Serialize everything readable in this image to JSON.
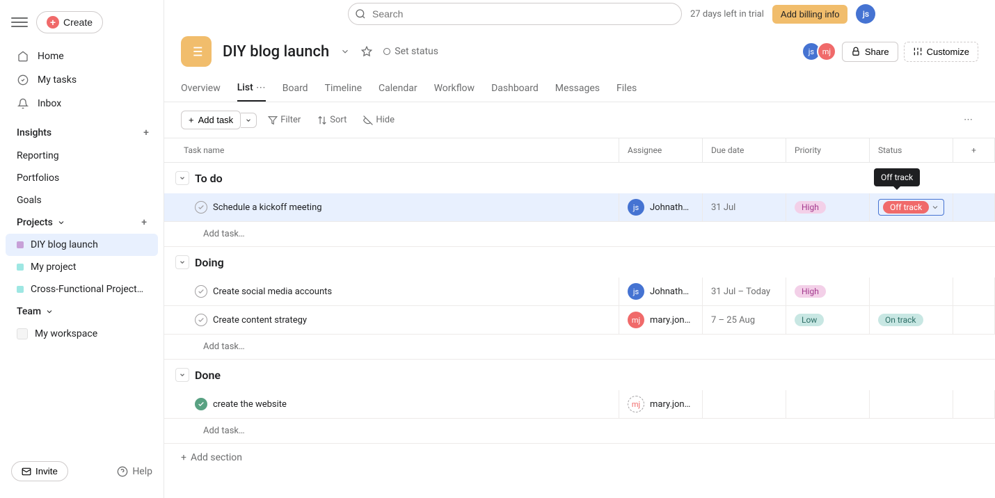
{
  "topbar": {
    "create_label": "Create",
    "search_placeholder": "Search",
    "trial_text": "27 days left in trial",
    "billing_label": "Add billing info",
    "user_initials": "js"
  },
  "sidebar": {
    "nav": [
      {
        "label": "Home",
        "icon": "home-icon"
      },
      {
        "label": "My tasks",
        "icon": "check-icon"
      },
      {
        "label": "Inbox",
        "icon": "bell-icon"
      }
    ],
    "insights_label": "Insights",
    "insights": [
      {
        "label": "Reporting"
      },
      {
        "label": "Portfolios"
      },
      {
        "label": "Goals"
      }
    ],
    "projects_label": "Projects",
    "projects": [
      {
        "label": "DIY blog launch",
        "color": "#c7a0d8",
        "active": true
      },
      {
        "label": "My project",
        "color": "#9ee7e3"
      },
      {
        "label": "Cross-Functional Project…",
        "color": "#9ee7e3"
      }
    ],
    "team_label": "Team",
    "team": [
      {
        "label": "My workspace"
      }
    ],
    "invite_label": "Invite",
    "help_label": "Help"
  },
  "project": {
    "title": "DIY blog launch",
    "status_label": "Set status",
    "share_label": "Share",
    "customize_label": "Customize",
    "members": [
      {
        "initials": "js",
        "color": "#4573d2"
      },
      {
        "initials": "mj",
        "color": "#f06a6a"
      }
    ]
  },
  "tabs": [
    {
      "label": "Overview"
    },
    {
      "label": "List",
      "active": true
    },
    {
      "label": "Board"
    },
    {
      "label": "Timeline"
    },
    {
      "label": "Calendar"
    },
    {
      "label": "Workflow"
    },
    {
      "label": "Dashboard"
    },
    {
      "label": "Messages"
    },
    {
      "label": "Files"
    }
  ],
  "toolbar": {
    "add_task_label": "Add task",
    "filter_label": "Filter",
    "sort_label": "Sort",
    "hide_label": "Hide"
  },
  "columns": {
    "name": "Task name",
    "assignee": "Assignee",
    "due": "Due date",
    "priority": "Priority",
    "status": "Status"
  },
  "tooltip_text": "Off track",
  "sections": [
    {
      "title": "To do",
      "tasks": [
        {
          "name": "Schedule a kickoff meeting",
          "assignee": {
            "initials": "js",
            "color": "#4573d2",
            "name": "Johnathan…"
          },
          "due": "31 Jul",
          "priority": {
            "label": "High",
            "class": "pill-high"
          },
          "status": {
            "label": "Off track",
            "class": "pill-offtrack"
          },
          "selected": true,
          "status_editing": true
        }
      ],
      "add_label": "Add task…"
    },
    {
      "title": "Doing",
      "tasks": [
        {
          "name": "Create social media accounts",
          "assignee": {
            "initials": "js",
            "color": "#4573d2",
            "name": "Johnathan…"
          },
          "due": "31 Jul – Today",
          "priority": {
            "label": "High",
            "class": "pill-high"
          },
          "status": null
        },
        {
          "name": "Create content strategy",
          "assignee": {
            "initials": "mj",
            "color": "#f06a6a",
            "name": "mary.jones…"
          },
          "due": "7 – 25 Aug",
          "priority": {
            "label": "Low",
            "class": "pill-low"
          },
          "status": {
            "label": "On track",
            "class": "pill-ontrack"
          }
        }
      ],
      "add_label": "Add task…"
    },
    {
      "title": "Done",
      "tasks": [
        {
          "name": "create the website",
          "done": true,
          "assignee": {
            "initials": "mj",
            "color": "#f06a6a",
            "name": "mary.jones…",
            "dashed": true
          },
          "due": "",
          "priority": null,
          "status": null
        }
      ],
      "add_label": "Add task…"
    }
  ],
  "add_section_label": "Add section"
}
